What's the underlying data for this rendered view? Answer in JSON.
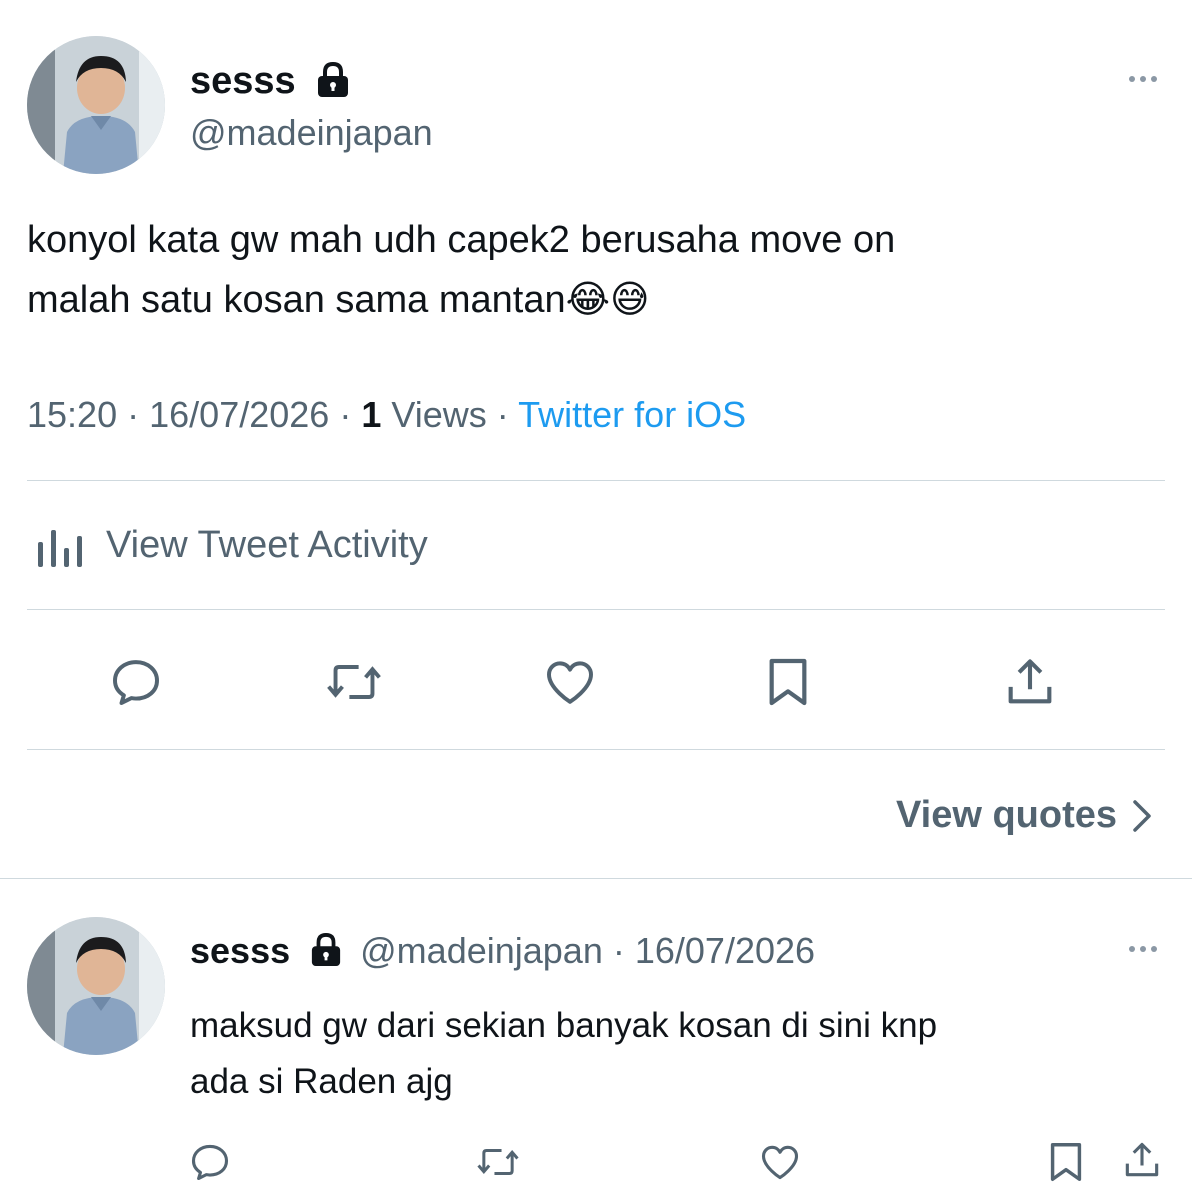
{
  "main_tweet": {
    "author": {
      "display_name": "sesss",
      "handle": "@madeinjapan",
      "protected_icon": "lock-icon",
      "avatar": "avatar-photo"
    },
    "text_line1": "konyol kata gw mah udh capek2 berusaha move on",
    "text_line2": "malah satu kosan sama mantan😂😅",
    "time": "15:20",
    "separator": "·",
    "date": "16/07/2026",
    "views_count": "1",
    "views_label": "Views",
    "source": "Twitter for iOS",
    "activity_label": "View Tweet Activity",
    "actions": [
      "reply-icon",
      "retweet-icon",
      "like-icon",
      "bookmark-icon",
      "share-icon"
    ],
    "view_quotes_label": "View quotes"
  },
  "reply_tweet": {
    "author": {
      "display_name": "sesss",
      "handle": "@madeinjapan",
      "protected_icon": "lock-icon"
    },
    "date_meta": "· 16/07/2026",
    "text_line1": "maksud gw dari sekian banyak kosan di sini knp",
    "text_line2": "ada si Raden ajg",
    "actions": [
      "reply-icon",
      "retweet-icon",
      "like-icon",
      "bookmark-icon",
      "share-icon"
    ]
  },
  "colors": {
    "text_primary": "#0f1419",
    "text_secondary": "#536471",
    "link": "#1d9bf0",
    "divider": "#cfd9de"
  }
}
